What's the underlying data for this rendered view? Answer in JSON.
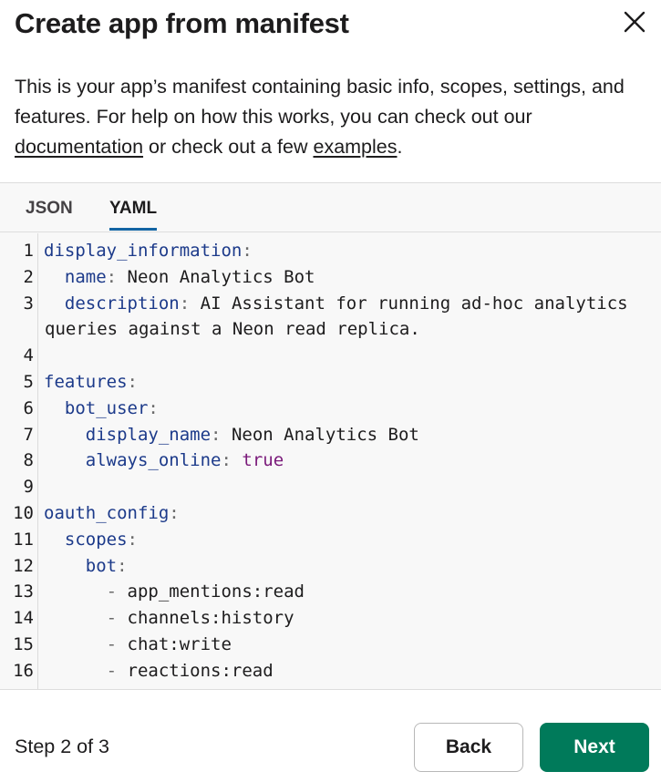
{
  "header": {
    "title": "Create app from manifest"
  },
  "intro": {
    "text_before": "This is your app’s manifest containing basic info, scopes, settings, and features. For help on how this works, you can check out our ",
    "link_docs": "documentation",
    "text_mid": " or check out a few ",
    "link_examples": "examples",
    "text_end": "."
  },
  "tabs": [
    {
      "label": "JSON",
      "active": false
    },
    {
      "label": "YAML",
      "active": true
    }
  ],
  "code_lines": [
    {
      "n": "1",
      "indent": "",
      "key": "display_information",
      "colon": ":",
      "value": ""
    },
    {
      "n": "2",
      "indent": "  ",
      "key": "name",
      "colon": ":",
      "value": " Neon Analytics Bot"
    },
    {
      "n": "3",
      "indent": "  ",
      "key": "description",
      "colon": ":",
      "value": " AI Assistant for running ad-hoc analytics"
    },
    {
      "n": "",
      "indent": "",
      "key": "",
      "colon": "",
      "value": "queries against a Neon read replica."
    },
    {
      "n": "4",
      "indent": "",
      "key": "",
      "colon": "",
      "value": ""
    },
    {
      "n": "5",
      "indent": "",
      "key": "features",
      "colon": ":",
      "value": ""
    },
    {
      "n": "6",
      "indent": "  ",
      "key": "bot_user",
      "colon": ":",
      "value": ""
    },
    {
      "n": "7",
      "indent": "    ",
      "key": "display_name",
      "colon": ":",
      "value": " Neon Analytics Bot"
    },
    {
      "n": "8",
      "indent": "    ",
      "key": "always_online",
      "colon": ":",
      "value": " ",
      "bool": "true"
    },
    {
      "n": "9",
      "indent": "",
      "key": "",
      "colon": "",
      "value": ""
    },
    {
      "n": "10",
      "indent": "",
      "key": "oauth_config",
      "colon": ":",
      "value": ""
    },
    {
      "n": "11",
      "indent": "  ",
      "key": "scopes",
      "colon": ":",
      "value": ""
    },
    {
      "n": "12",
      "indent": "    ",
      "key": "bot",
      "colon": ":",
      "value": ""
    },
    {
      "n": "13",
      "indent": "      ",
      "key": "",
      "colon": "",
      "dash": "- ",
      "value": "app_mentions:read"
    },
    {
      "n": "14",
      "indent": "      ",
      "key": "",
      "colon": "",
      "dash": "- ",
      "value": "channels:history"
    },
    {
      "n": "15",
      "indent": "      ",
      "key": "",
      "colon": "",
      "dash": "- ",
      "value": "chat:write"
    },
    {
      "n": "16",
      "indent": "      ",
      "key": "",
      "colon": "",
      "dash": "- ",
      "value": "reactions:read"
    }
  ],
  "footer": {
    "step": "Step 2 of 3",
    "back_label": "Back",
    "next_label": "Next",
    "next_color": "#007a5a"
  },
  "icons": {
    "close": "close-icon"
  }
}
